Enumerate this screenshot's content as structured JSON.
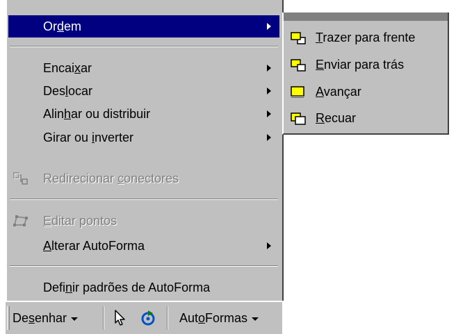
{
  "menu": {
    "items": [
      {
        "pre": "Or",
        "acc": "d",
        "post": "em",
        "submenu": true,
        "active": true
      },
      {
        "pre": "Encai",
        "acc": "x",
        "post": "ar",
        "submenu": true
      },
      {
        "pre": "Des",
        "acc": "l",
        "post": "ocar",
        "submenu": true
      },
      {
        "pre": "Alin",
        "acc": "h",
        "post": "ar ou distribuir",
        "submenu": true
      },
      {
        "pre": "Girar ou ",
        "acc": "i",
        "post": "nverter",
        "submenu": true
      },
      {
        "pre": "Redirecionar ",
        "acc": "c",
        "post": "onectores",
        "disabled": true,
        "icon": "connector-icon"
      },
      {
        "pre": "",
        "acc": "E",
        "post": "ditar pontos",
        "disabled": true,
        "icon": "edit-points-icon"
      },
      {
        "pre": "",
        "acc": "A",
        "post": "lterar AutoForma",
        "submenu": true
      },
      {
        "pre": "Defi",
        "acc": "n",
        "post": "ir padrões de AutoForma"
      }
    ]
  },
  "submenu": {
    "items": [
      {
        "pre": "",
        "acc": "T",
        "post": "razer para frente",
        "icon": "bring-to-front-icon"
      },
      {
        "pre": "",
        "acc": "E",
        "post": "nviar para trás",
        "icon": "send-to-back-icon"
      },
      {
        "pre": "",
        "acc": "A",
        "post": "vançar",
        "icon": "bring-forward-icon"
      },
      {
        "pre": "",
        "acc": "R",
        "post": "ecuar",
        "icon": "send-backward-icon"
      }
    ]
  },
  "toolbar": {
    "draw": {
      "pre": "De",
      "acc": "s",
      "post": "enhar"
    },
    "autoshapes": {
      "pre": "Aut",
      "acc": "o",
      "post": "Formas"
    }
  },
  "colors": {
    "menu_bg": "#c0c0c0",
    "highlight": "#000080",
    "disabled_text": "#808080",
    "shape_fill": "#ffff00"
  }
}
